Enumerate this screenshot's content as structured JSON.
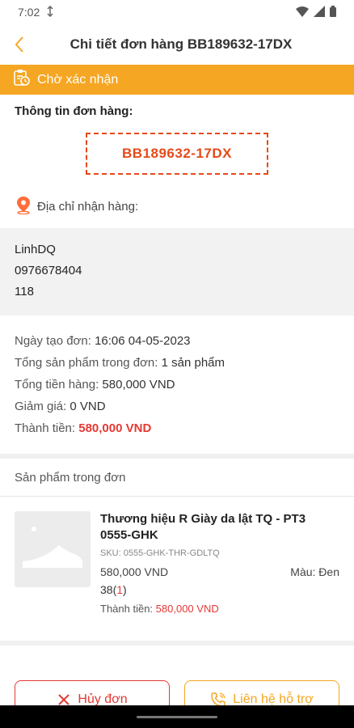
{
  "status_bar": {
    "time": "7:02"
  },
  "header": {
    "title": "Chi tiết đơn hàng BB189632-17DX"
  },
  "order_status": {
    "label": "Chờ xác nhận"
  },
  "order_info": {
    "label": "Thông tin đơn hàng:",
    "code": "BB189632-17DX"
  },
  "address": {
    "label": "Địa chỉ nhận hàng:",
    "name": "LinhDQ",
    "phone": "0976678404",
    "line": "118"
  },
  "details": {
    "created_label": "Ngày tạo đơn:",
    "created_value": "16:06 04-05-2023",
    "count_label": "Tổng sản phẩm trong đơn:",
    "count_value": "1 sản phẩm",
    "goods_label": "Tổng tiền hàng:",
    "goods_value": "580,000 VND",
    "discount_label": "Giảm giá:",
    "discount_value": "0 VND",
    "total_label": "Thành tiền:",
    "total_value": "580,000 VND"
  },
  "products": {
    "heading": "Sản phẩm trong đơn",
    "items": [
      {
        "name": "Thương hiệu R Giày da lật TQ - PT3 0555-GHK",
        "sku": "SKU: 0555-GHK-THR-GDLTQ",
        "price": "580,000 VND",
        "color": "Màu: Đen",
        "size": "38",
        "qty": "1",
        "total_label": "Thành tiền:",
        "total_value": "580,000 VND"
      }
    ]
  },
  "actions": {
    "cancel": "Hủy đơn",
    "support": "Liên hệ hỗ trợ"
  },
  "colors": {
    "accent": "#f5a623",
    "danger": "#e53935",
    "code": "#e64a19"
  }
}
